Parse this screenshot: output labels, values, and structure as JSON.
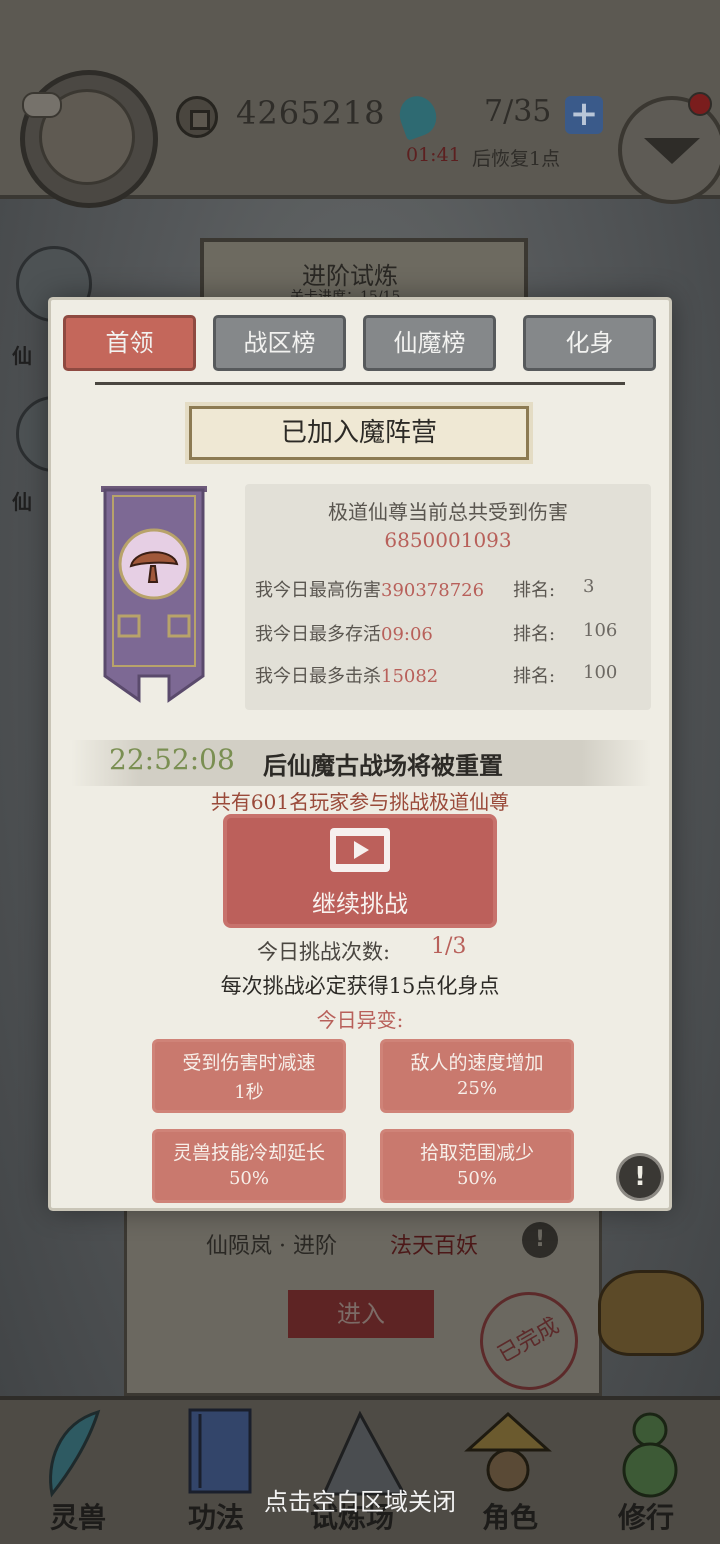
{
  "topbar": {
    "coins": "4265218",
    "energy": "7/35",
    "plus": "+",
    "timer": "01:41",
    "recover_text": "后恢复1点"
  },
  "side": {
    "item1_label": "仙",
    "item2_label": "仙"
  },
  "background_scroll": {
    "title": "进阶试炼",
    "subtitle": "关卡进度：15/15"
  },
  "stage": {
    "name": "仙陨岚 · 进阶",
    "subtitle": "法天百妖",
    "enter_label": "进入",
    "done_stamp": "已完成"
  },
  "popup": {
    "tabs": [
      {
        "label": "首领",
        "active": true
      },
      {
        "label": "战区榜",
        "active": false
      },
      {
        "label": "仙魔榜",
        "active": false
      },
      {
        "label": "化身",
        "active": false
      }
    ],
    "faction": "已加入魔阵营",
    "stats": {
      "title": "极道仙尊当前总共受到伤害",
      "total_damage": "6850001093",
      "rank_label": "排名:",
      "rows": [
        {
          "label": "我今日最高伤害",
          "value": "390378726",
          "rank": "3"
        },
        {
          "label": "我今日最多存活",
          "value": "09:06",
          "rank": "106"
        },
        {
          "label": "我今日最多击杀",
          "value": "15082",
          "rank": "100"
        }
      ]
    },
    "reset_time": "22:52:08",
    "reset_text": "后仙魔古战场将被重置",
    "participants": "共有601名玩家参与挑战极道仙尊",
    "challenge_button": "继续挑战",
    "attempts_label": "今日挑战次数:",
    "attempts_value": "1/3",
    "reward_note": "每次挑战必定获得15点化身点",
    "mutation_title": "今日异变:",
    "modifiers": [
      {
        "name": "受到伤害时减速",
        "value": "1秒"
      },
      {
        "name": "敌人的速度增加",
        "value": "25%"
      },
      {
        "name": "灵兽技能冷却延长",
        "value": "50%"
      },
      {
        "name": "拾取范围减少",
        "value": "50%"
      }
    ],
    "info_icon": "!"
  },
  "bottom_nav": [
    {
      "label": "灵兽",
      "icon": "feather-icon"
    },
    {
      "label": "功法",
      "icon": "book-icon"
    },
    {
      "label": "试炼场",
      "icon": "mountain-icon"
    },
    {
      "label": "角色",
      "icon": "hat-icon"
    },
    {
      "label": "修行",
      "icon": "gourd-icon"
    }
  ],
  "close_hint": "点击空白区域关闭",
  "colors": {
    "active_tab": "#c4675b",
    "inactive_tab": "#85888a",
    "highlight_red": "#b8605a",
    "timer_green": "#7a8f52",
    "modifier_card": "#c9796e"
  }
}
